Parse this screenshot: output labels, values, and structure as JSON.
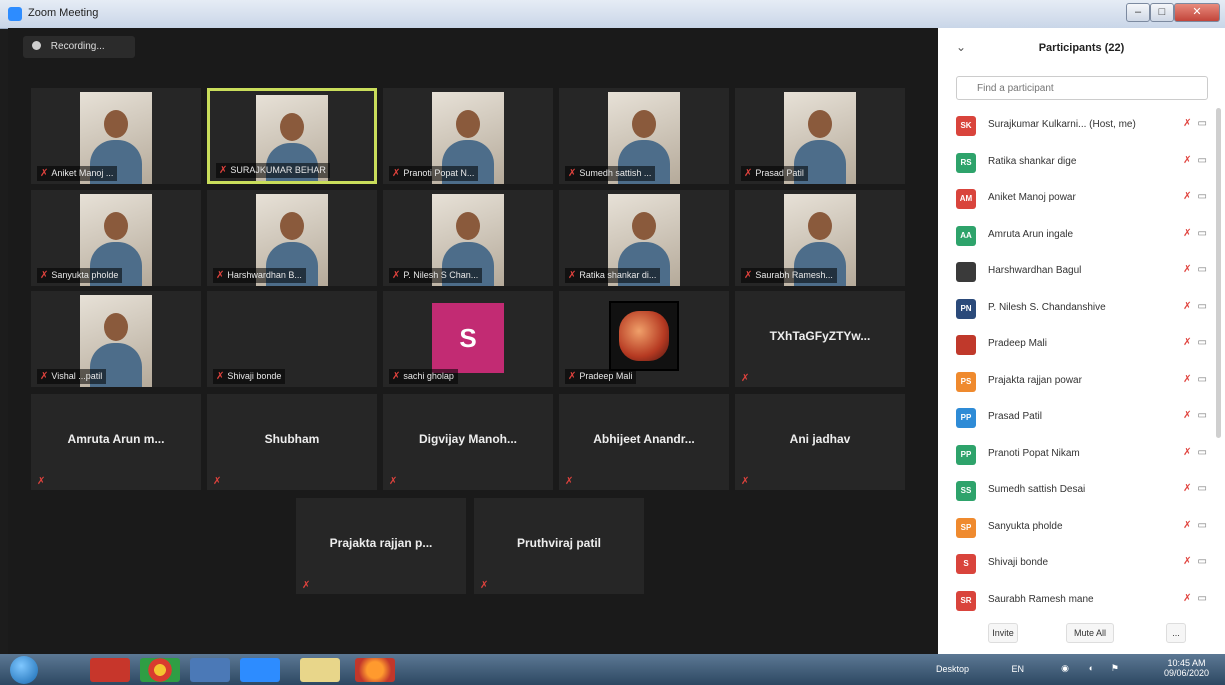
{
  "window": {
    "title": "Zoom Meeting",
    "min": "–",
    "max": "□",
    "close": "✕"
  },
  "recording": {
    "label": "Recording..."
  },
  "tiles": [
    {
      "type": "video",
      "name": "Aniket Manoj ..."
    },
    {
      "type": "video",
      "name": "SURAJKUMAR BEHAR",
      "active": true
    },
    {
      "type": "video",
      "name": "Pranoti Popat N..."
    },
    {
      "type": "video",
      "name": "Sumedh sattish ..."
    },
    {
      "type": "video",
      "name": "Prasad Patil"
    },
    {
      "type": "video",
      "name": "Sanyukta pholde"
    },
    {
      "type": "video",
      "name": "Harshwardhan B..."
    },
    {
      "type": "video",
      "name": "P. Nilesh S Chan..."
    },
    {
      "type": "video",
      "name": "Ratika shankar di..."
    },
    {
      "type": "video",
      "name": "Saurabh Ramesh..."
    },
    {
      "type": "video",
      "name": "Vishal ...patil"
    },
    {
      "type": "blank",
      "name": "Shivaji bonde"
    },
    {
      "type": "avatar",
      "letter": "S",
      "name": "sachi gholap"
    },
    {
      "type": "photo",
      "name": "Pradeep Mali"
    },
    {
      "type": "text",
      "label": "TXhTaGFyZTYw...",
      "name": ""
    },
    {
      "type": "text",
      "label": "Amruta Arun m..."
    },
    {
      "type": "text",
      "label": "Shubham"
    },
    {
      "type": "text",
      "label": "Digvijay Manoh..."
    },
    {
      "type": "text",
      "label": "Abhijeet Anandr..."
    },
    {
      "type": "text",
      "label": "Ani jadhav"
    },
    {
      "type": "text",
      "label": "Prajakta rajjan p..."
    },
    {
      "type": "text",
      "label": "Pruthviraj patil"
    }
  ],
  "panel": {
    "title": "Participants (22)",
    "collapse": "⌄",
    "search_placeholder": "Find a participant",
    "participants": [
      {
        "initials": "SK",
        "color": "#d9443c",
        "name": "Surajkumar Kulkarni... (Host, me)"
      },
      {
        "initials": "RS",
        "color": "#2ea36b",
        "name": "Ratika shankar dige"
      },
      {
        "initials": "AM",
        "color": "#d9443c",
        "name": "Aniket Manoj powar"
      },
      {
        "initials": "AA",
        "color": "#2ea36b",
        "name": "Amruta Arun ingale"
      },
      {
        "initials": "",
        "color": "#3a3a3a",
        "name": "Harshwardhan Bagul"
      },
      {
        "initials": "PN",
        "color": "#2b4a7a",
        "name": "P. Nilesh S. Chandanshive"
      },
      {
        "initials": "",
        "color": "#c0392b",
        "name": "Pradeep Mali"
      },
      {
        "initials": "PS",
        "color": "#ef8a2e",
        "name": "Prajakta rajjan powar"
      },
      {
        "initials": "PP",
        "color": "#2e8bd6",
        "name": "Prasad Patil"
      },
      {
        "initials": "PP",
        "color": "#2ea36b",
        "name": "Pranoti Popat Nikam"
      },
      {
        "initials": "SS",
        "color": "#2ea36b",
        "name": "Sumedh sattish Desai"
      },
      {
        "initials": "SP",
        "color": "#ef8a2e",
        "name": "Sanyukta pholde"
      },
      {
        "initials": "S",
        "color": "#d9443c",
        "name": "Shivaji bonde"
      },
      {
        "initials": "SR",
        "color": "#d9443c",
        "name": "Saurabh Ramesh mane"
      }
    ],
    "invite_label": "Invite",
    "mute_all_label": "Mute All",
    "more_label": "..."
  },
  "taskbar": {
    "tray_desktop": "Desktop",
    "tray_lang": "EN",
    "clock_time": "10:45 AM",
    "clock_date": "09/06/2020"
  }
}
